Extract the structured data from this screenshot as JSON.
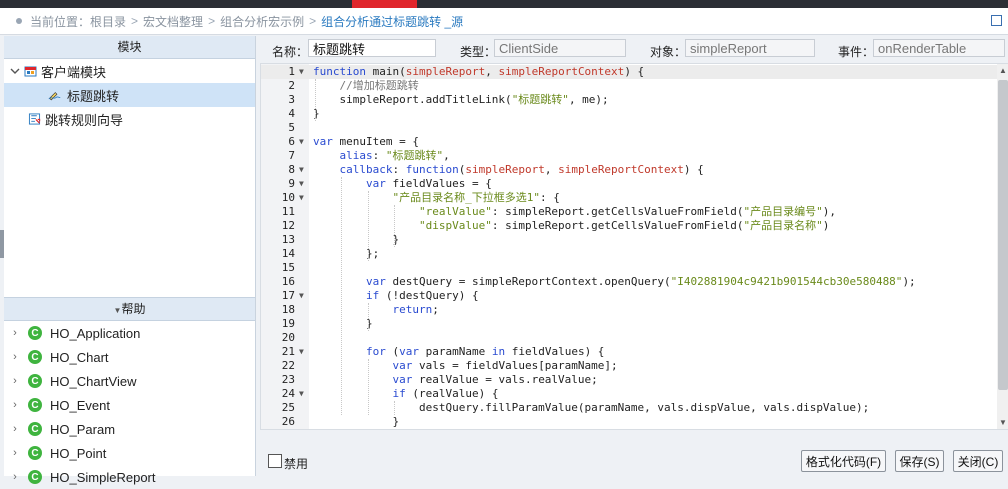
{
  "breadcrumb": {
    "label": "当前位置：",
    "items": [
      "根目录",
      "宏文档整理",
      "组合分析宏示例",
      "组合分析通过标题跳转 _源"
    ]
  },
  "left_panel": {
    "module_header": "模块",
    "tree": {
      "client_module": "客户端模块",
      "title_jump": "标题跳转",
      "jump_rule_wizard": "跳转规则向导"
    },
    "help_header": "帮助",
    "help_badge": "C",
    "help_items": [
      "HO_Application",
      "HO_Chart",
      "HO_ChartView",
      "HO_Event",
      "HO_Param",
      "HO_Point",
      "HO_SimpleReport"
    ]
  },
  "props": {
    "name_label": "名称：",
    "name_value": "标题跳转",
    "type_label": "类型：",
    "type_value": "ClientSide",
    "object_label": "对象：",
    "object_value": "simpleReport",
    "event_label": "事件：",
    "event_value": "onRenderTable"
  },
  "code_lines": [
    "function main(simpleReport, simpleReportContext) {",
    "    //增加标题跳转",
    "    simpleReport.addTitleLink(\"标题跳转\", me);",
    "}",
    "",
    "var menuItem = {",
    "    alias: \"标题跳转\",",
    "    callback: function(simpleReport, simpleReportContext) {",
    "        var fieldValues = {",
    "            \"产品目录名称_下拉框多选1\": {",
    "                \"realValue\": simpleReport.getCellsValueFromField(\"产品目录编号\"),",
    "                \"dispValue\": simpleReport.getCellsValueFromField(\"产品目录名称\")",
    "            }",
    "        };",
    "",
    "        var destQuery = simpleReportContext.openQuery(\"I402881904c9421b901544cb30e580488\");",
    "        if (!destQuery) {",
    "            return;",
    "        }",
    "",
    "        for (var paramName in fieldValues) {",
    "            var vals = fieldValues[paramName];",
    "            var realValue = vals.realValue;",
    "            if (realValue) {",
    "                destQuery.fillParamValue(paramName, vals.dispValue, vals.dispValue);",
    "            }"
  ],
  "fold_lines": [
    1,
    6,
    8,
    9,
    10,
    17,
    21,
    24
  ],
  "footer": {
    "disable_label": "禁用",
    "format_button": "格式化代码(F)",
    "save_button": "保存(S)",
    "close_button": "关闭(C)"
  },
  "colors": {
    "keyword": "#2a4bd0",
    "string": "#6a8a1b",
    "param": "#c0392b",
    "comment": "#777777",
    "help_badge": "#3fb43f",
    "accent": "#2a7ac0"
  }
}
